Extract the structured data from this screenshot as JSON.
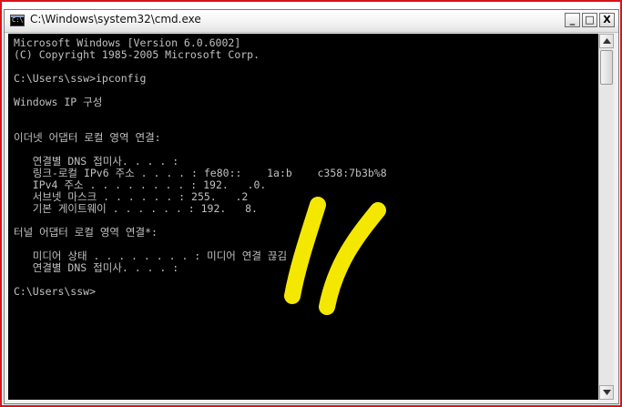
{
  "window": {
    "title": "C:\\Windows\\system32\\cmd.exe",
    "icon_text": "C:\\",
    "controls": {
      "minimize": "_",
      "maximize": "□",
      "close": "X"
    }
  },
  "console": {
    "lines": [
      "Microsoft Windows [Version 6.0.6002]",
      "(C) Copyright 1985-2005 Microsoft Corp.",
      "",
      "C:\\Users\\ssw>ipconfig",
      "",
      "Windows IP 구성",
      "",
      "",
      "이더넷 어댑터 로컬 영역 연결:",
      "",
      "   연결별 DNS 접미사. . . . :",
      "   링크-로컬 IPv6 주소 . . . . : fe80::    1a:b    c358:7b3b%8",
      "   IPv4 주소 . . . . . . . . : 192.   .0.",
      "   서브넷 마스크 . . . . . . : 255.   .2",
      "   기본 게이트웨이 . . . . . . : 192.   8.",
      "",
      "터널 어댑터 로컬 영역 연결*:",
      "",
      "   미디어 상태 . . . . . . . . : 미디어 연결 끊김",
      "   연결별 DNS 접미사. . . . :",
      "",
      "C:\\Users\\ssw>"
    ]
  },
  "colors": {
    "console_bg": "#000000",
    "console_fg": "#c0c0c0",
    "redaction": "#f5e800",
    "frame_border": "#d8141a"
  },
  "icons": {
    "window_icon": "cmd-console-icon",
    "scroll_up": "triangle-up-icon",
    "scroll_down": "triangle-down-icon"
  }
}
